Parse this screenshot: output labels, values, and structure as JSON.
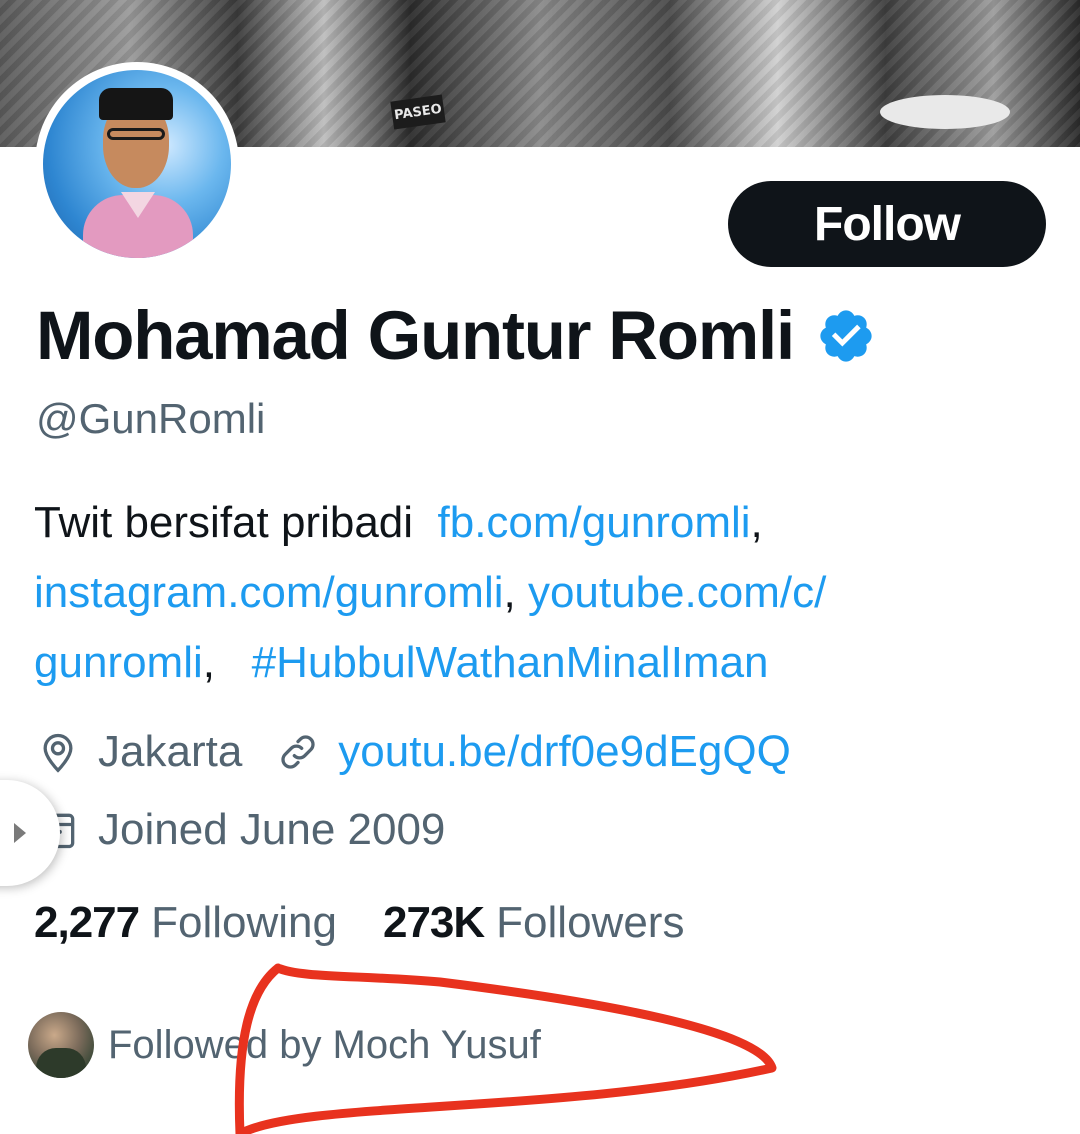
{
  "banner": {
    "sign_text": "PASEO"
  },
  "profile": {
    "follow_button_label": "Follow",
    "display_name": "Mohamad Guntur Romli",
    "handle": "@GunRomli",
    "verified_icon": "verified-badge",
    "accent_color": "#1d9bf0"
  },
  "bio": {
    "text": "Twit bersifat pribadi",
    "link1": "fb.com/gunromli",
    "link2": "instagram.com/gunromli",
    "link3_line1": "youtube.com/c/",
    "link3_line2": "gunromli",
    "hashtag": "#HubbulWathanMinalIman"
  },
  "meta": {
    "location": "Jakarta",
    "url": "youtu.be/drf0e9dEgQQ",
    "joined": "Joined June 2009"
  },
  "stats": {
    "following_count": "2,277",
    "following_label": "Following",
    "followers_count": "273K",
    "followers_label": "Followers"
  },
  "followed_by": {
    "text": "Followed by Moch Yusuf"
  }
}
